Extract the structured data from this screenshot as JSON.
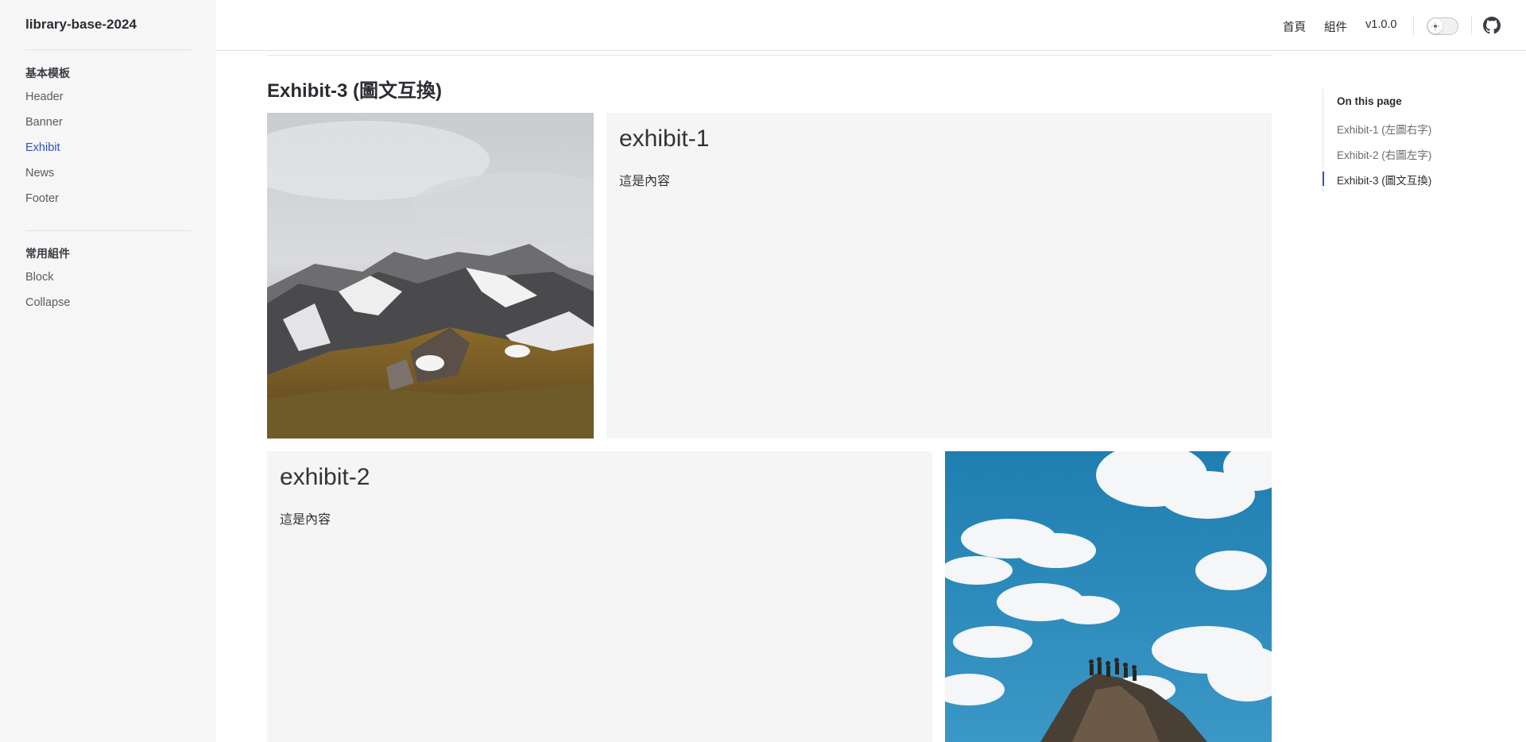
{
  "sidebar": {
    "brand": "library-base-2024",
    "groups": [
      {
        "title": "基本模板",
        "items": [
          {
            "label": "Header"
          },
          {
            "label": "Banner"
          },
          {
            "label": "Exhibit",
            "active": true
          },
          {
            "label": "News"
          },
          {
            "label": "Footer"
          }
        ]
      },
      {
        "title": "常用組件",
        "items": [
          {
            "label": "Block"
          },
          {
            "label": "Collapse"
          }
        ]
      }
    ]
  },
  "topbar": {
    "links": [
      "首頁",
      "組件",
      "v1.0.0"
    ],
    "theme_toggle_icon": "sun-icon",
    "github_icon": "github-icon"
  },
  "main": {
    "section_title": "Exhibit-3 (圖文互換)",
    "exhibits": [
      {
        "title": "exhibit-1",
        "body": "這是內容",
        "image": "snowy-mountain-photo"
      },
      {
        "title": "exhibit-2",
        "body": "這是內容",
        "image": "hilltop-sky-photo"
      }
    ]
  },
  "toc": {
    "title": "On this page",
    "items": [
      {
        "label": "Exhibit-1 (左圖右字)"
      },
      {
        "label": "Exhibit-2 (右圖左字)"
      },
      {
        "label": "Exhibit-3 (圖文互換)",
        "active": true
      }
    ]
  },
  "colors": {
    "accent": "#2f4fbf",
    "sidebar_bg": "#f6f6f7",
    "card_bg": "#f5f5f5"
  }
}
